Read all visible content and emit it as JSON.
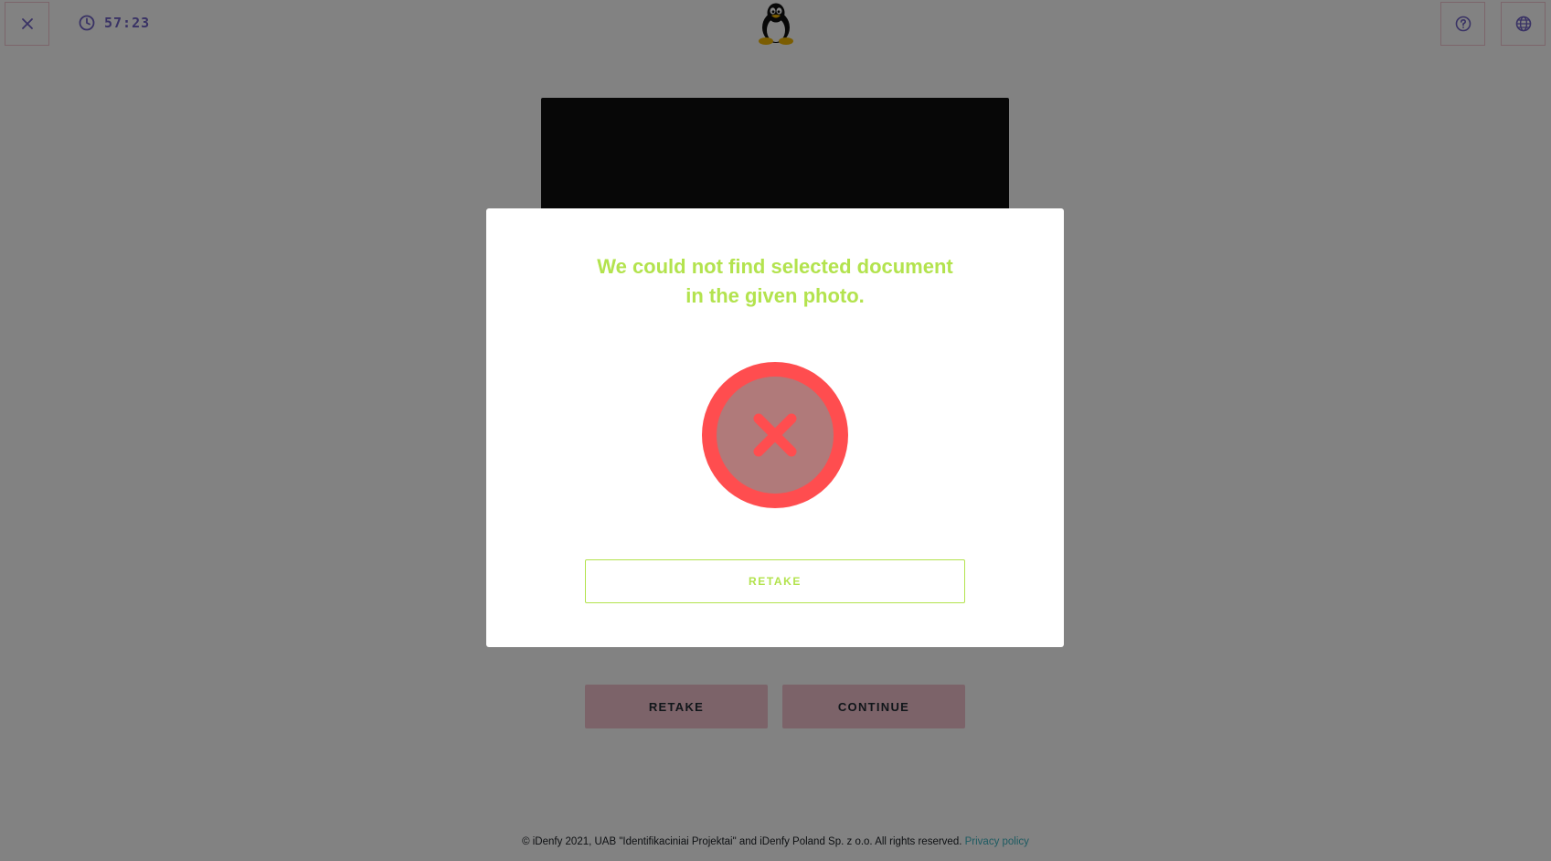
{
  "header": {
    "timer": "57:23",
    "close_icon": "close-icon",
    "timer_icon": "clock-icon",
    "logo_icon": "penguin-logo",
    "help_icon": "help-circle-icon",
    "language_icon": "globe-icon"
  },
  "background_actions": {
    "retake_label": "RETAKE",
    "continue_label": "CONTINUE"
  },
  "modal": {
    "title_line1": "We could not find selected document",
    "title_line2": "in the given photo.",
    "status_icon": "error-x-icon",
    "retake_label": "RETAKE"
  },
  "footer": {
    "copyright": "© iDenfy 2021, UAB \"Identifikaciniai Projektai\" and iDenfy Poland Sp. z o.o. All rights reserved.",
    "privacy_link": "Privacy policy"
  },
  "colors": {
    "accent_green": "#b3e34e",
    "error_red": "#ff4d4f",
    "timer_purple": "#7163c6",
    "button_pink": "#f4c3cf"
  }
}
